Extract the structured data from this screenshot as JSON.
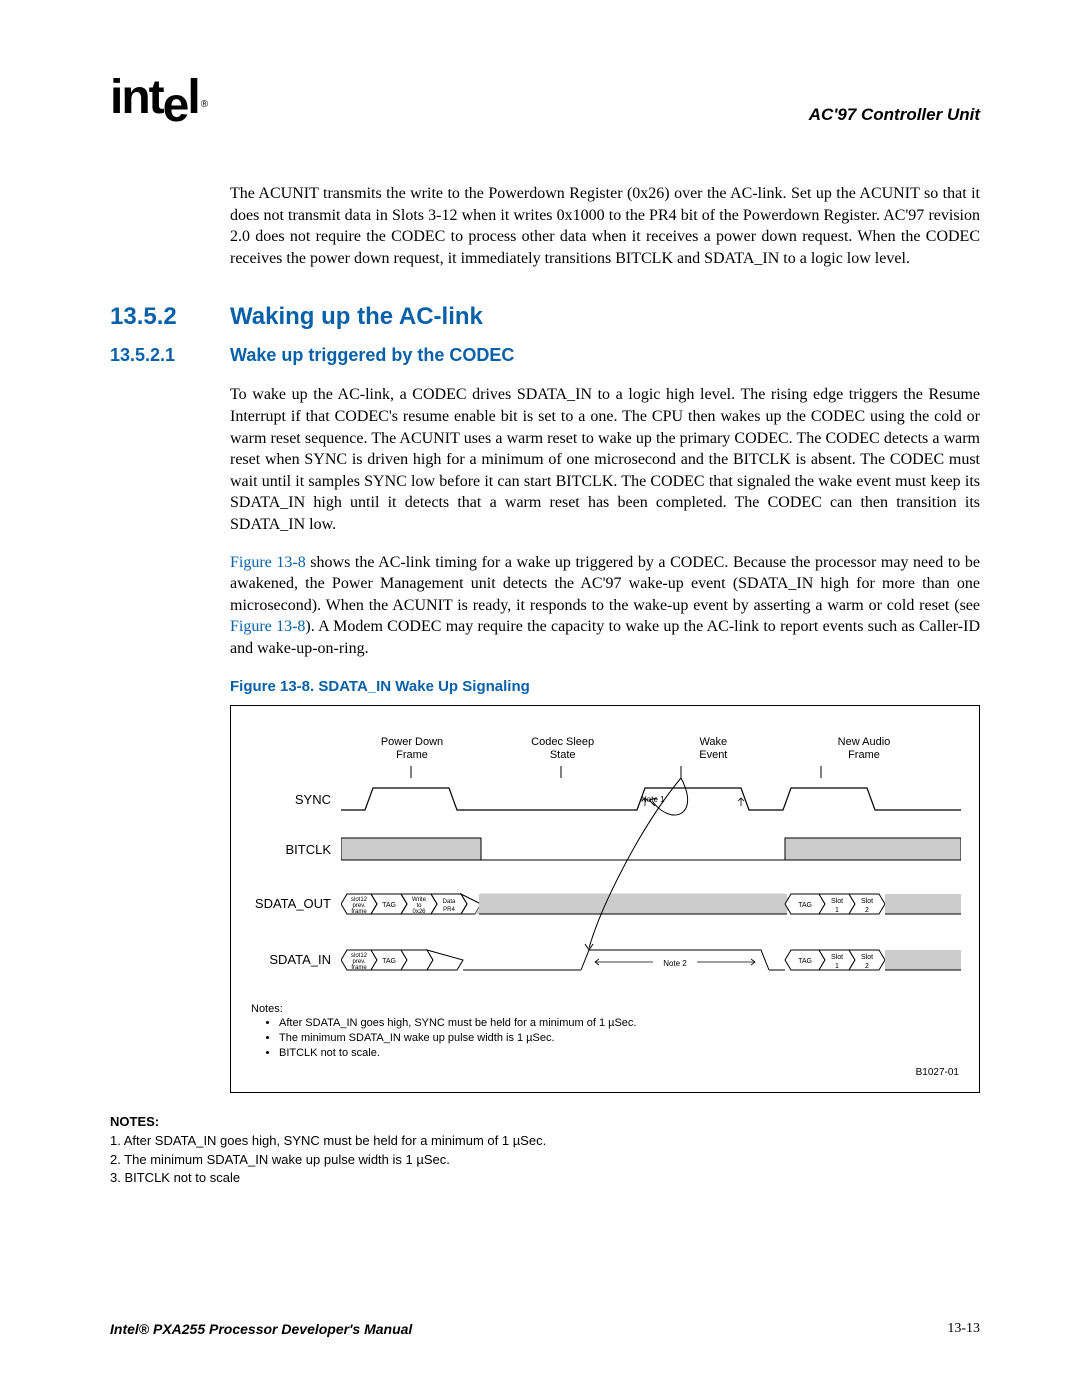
{
  "header": {
    "logo_text": "intel",
    "logo_reg": "®",
    "chapter_title": "AC'97 Controller Unit"
  },
  "intro_paragraph": "The ACUNIT transmits the write to the Powerdown Register (0x26) over the AC-link. Set up the ACUNIT so that it does not transmit data in Slots 3-12 when it writes 0x1000 to the PR4 bit of the Powerdown Register. AC'97 revision 2.0 does not require the CODEC to process other data when it receives a power down request. When the CODEC receives the power down request, it immediately transitions BITCLK and SDATA_IN to a logic low level.",
  "h2": {
    "num": "13.5.2",
    "title": "Waking up the AC-link"
  },
  "h3": {
    "num": "13.5.2.1",
    "title": "Wake up triggered by the CODEC"
  },
  "p1": "To wake up the AC-link, a CODEC drives SDATA_IN to a logic high level. The rising edge triggers the Resume Interrupt if that CODEC's resume enable bit is set to a one. The CPU then wakes up the CODEC using the cold or warm reset sequence. The ACUNIT uses a warm reset to wake up the primary CODEC. The CODEC detects a warm reset when SYNC is driven high for a minimum of one microsecond and the BITCLK is absent. The CODEC must wait until it samples SYNC low before it can start BITCLK. The CODEC that signaled the wake event must keep its SDATA_IN high until it detects that a warm reset has been completed. The CODEC can then transition its SDATA_IN low.",
  "p2_pre": "",
  "p2_link1": "Figure 13-8",
  "p2_mid": " shows the AC-link timing for a wake up triggered by a CODEC. Because the processor may need to be awakened, the Power Management unit detects the AC'97 wake-up event (SDATA_IN high for more than one microsecond). When the ACUNIT is ready, it responds to the wake-up event by asserting a warm or cold reset (see ",
  "p2_link2": "Figure 13-8",
  "p2_post": "). A Modem CODEC may require the capacity to wake up the AC-link to report events such as Caller-ID and wake-up-on-ring.",
  "figure": {
    "caption": "Figure 13-8. SDATA_IN Wake Up Signaling",
    "annotations": {
      "a1": "Power Down\nFrame",
      "a2": "Codec Sleep\nState",
      "a3": "Wake\nEvent",
      "a4": "New Audio\nFrame"
    },
    "signals": {
      "s1": "SYNC",
      "s2": "BITCLK",
      "s3": "SDATA_OUT",
      "s4": "SDATA_IN"
    },
    "note1": "Note 1",
    "note2": "Note 2",
    "cells_out": {
      "c1a": "slot12",
      "c1b": "prev.",
      "c1c": "frame",
      "c2": "TAG",
      "c3a": "Write",
      "c3b": "to",
      "c3c": "0x26",
      "c4a": "Data",
      "c4b": "PR4",
      "c5": "TAG",
      "c6a": "Slot",
      "c6b": "1",
      "c7a": "Slot",
      "c7b": "2"
    },
    "cells_in": {
      "c1a": "slot12",
      "c1b": "prev.",
      "c1c": "frame",
      "c2": "TAG",
      "c5": "TAG",
      "c6a": "Slot",
      "c6b": "1",
      "c7a": "Slot",
      "c7b": "2"
    },
    "notes_heading": "Notes:",
    "notes": [
      "After SDATA_IN goes high, SYNC must be held for a minimum of 1 µSec.",
      "The minimum SDATA_IN wake up pulse width is 1 µSec.",
      "BITCLK not to scale."
    ],
    "id": "B1027-01"
  },
  "bottom_notes": {
    "heading": "NOTES:",
    "items": [
      "1. After SDATA_IN goes high, SYNC must be held for a minimum of 1 µSec.",
      "2. The minimum SDATA_IN wake up pulse width is 1 µSec.",
      "3. BITCLK not to scale"
    ]
  },
  "footer": {
    "left": "Intel® PXA255 Processor Developer's Manual",
    "right": "13-13"
  }
}
